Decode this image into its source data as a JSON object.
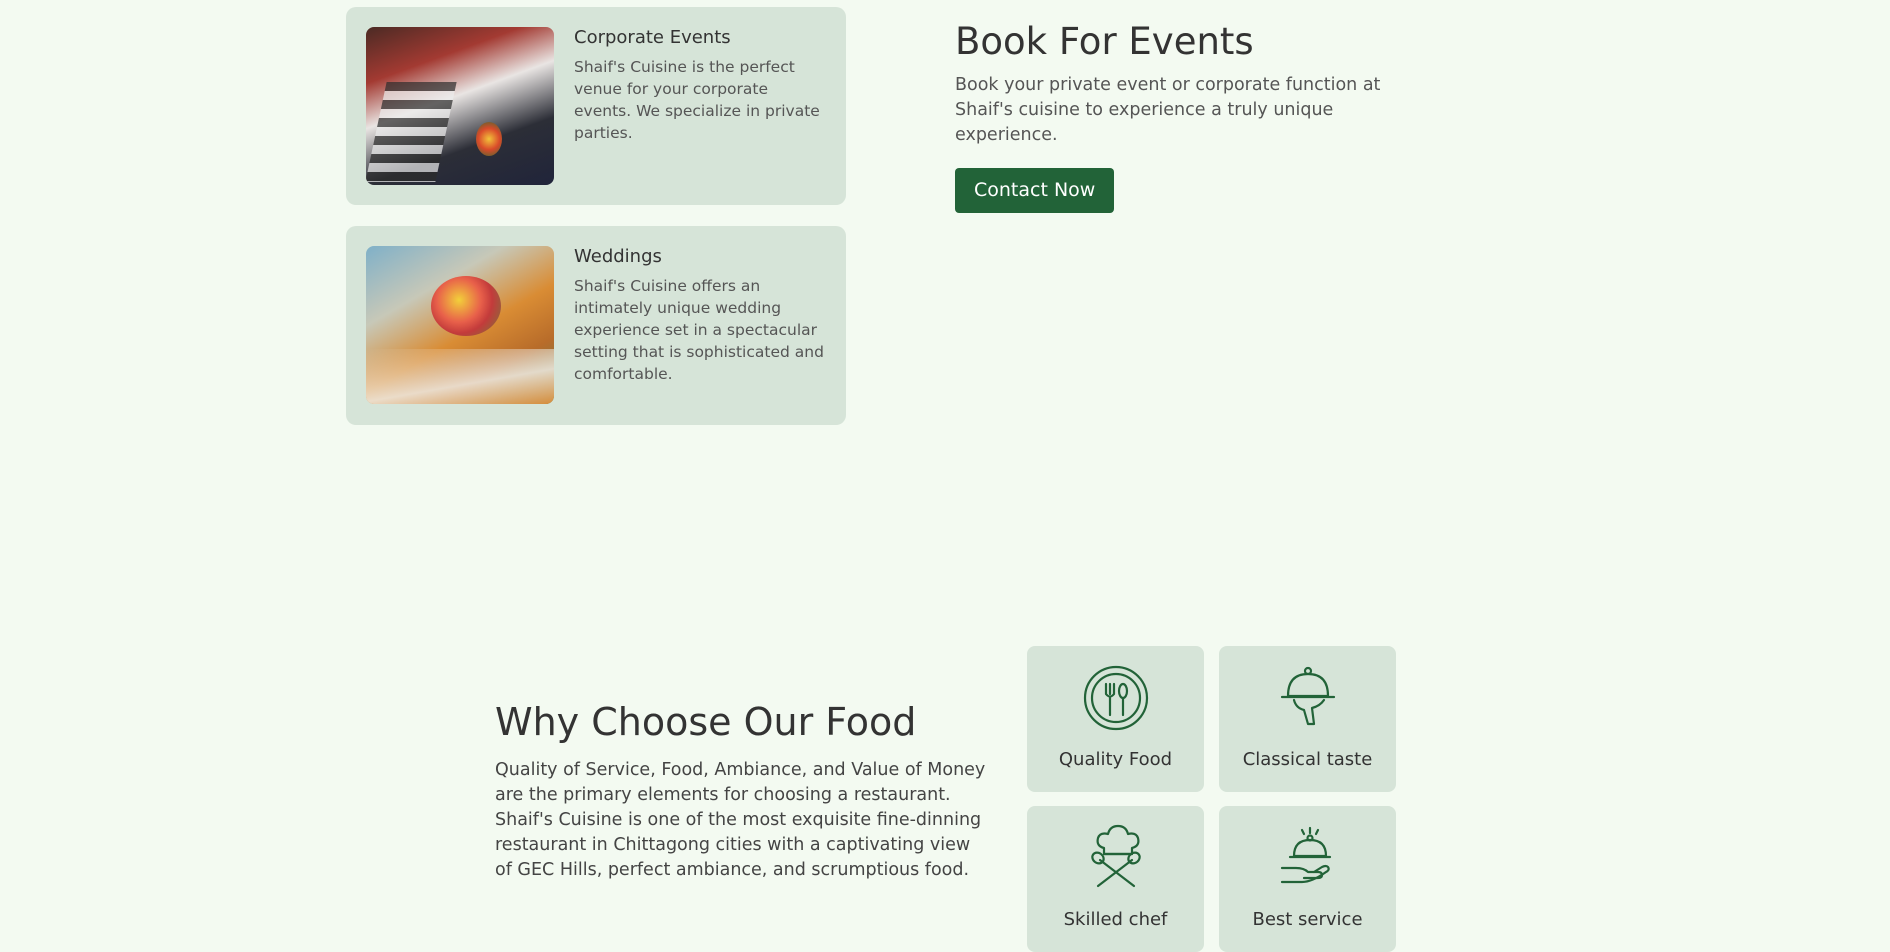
{
  "events": [
    {
      "title": "Corporate Events",
      "description": "Shaif's Cuisine is the perfect venue for your corporate events. We specialize in private parties."
    },
    {
      "title": "Weddings",
      "description": "Shaif's Cuisine offers an intimately unique wedding experience set in a spectacular setting that is sophisticated and comfortable."
    }
  ],
  "book": {
    "title": "Book For Events",
    "description": "Book your private event or corporate function at Shaif's cuisine to experience a truly unique experience.",
    "button_label": "Contact Now"
  },
  "why": {
    "title": "Why Choose Our Food",
    "description": "Quality of Service, Food, Ambiance, and Value of Money are the primary elements for choosing a restaurant. Shaif's Cuisine is one of the most exquisite fine-dinning restaurant in Chittagong cities with a captivating view of GEC Hills, perfect ambiance, and scrumptious food."
  },
  "features": [
    {
      "label": "Quality Food",
      "icon": "fork-spoon-plate-icon"
    },
    {
      "label": "Classical taste",
      "icon": "cloche-icon"
    },
    {
      "label": "Skilled chef",
      "icon": "chef-hat-icon"
    },
    {
      "label": "Best service",
      "icon": "serving-hand-icon"
    }
  ],
  "colors": {
    "background": "#f3faf1",
    "card": "#d6e4d8",
    "accent": "#226338",
    "icon": "#226338"
  }
}
